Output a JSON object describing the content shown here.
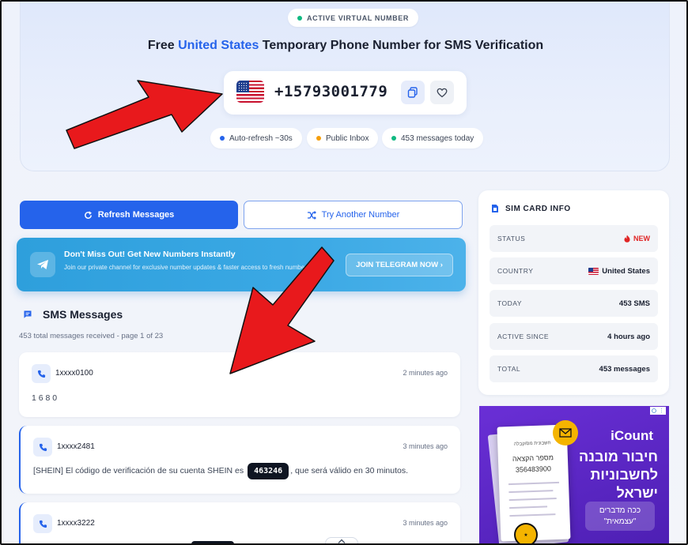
{
  "hero": {
    "badge": "ACTIVE VIRTUAL NUMBER",
    "title_prefix": "Free ",
    "title_country": "United States",
    "title_suffix": " Temporary Phone Number for SMS Verification",
    "phone_number": "+15793001779",
    "pills": [
      {
        "label": "Auto-refresh ~30s",
        "dot_color": "#2563eb"
      },
      {
        "label": "Public Inbox",
        "dot_color": "#f59e0b"
      },
      {
        "label": "453 messages today",
        "dot_color": "#10b981"
      }
    ]
  },
  "actions": {
    "refresh_label": "Refresh Messages",
    "try_label": "Try Another Number"
  },
  "telegram": {
    "title": "Don't Miss Out! Get New Numbers Instantly",
    "subtitle": "Join our private channel for exclusive number updates & faster access to fresh numbers",
    "button": "JOIN TELEGRAM NOW ›"
  },
  "sms": {
    "title": "SMS Messages",
    "count_text": "453 total messages received - page 1 of 23",
    "messages": [
      {
        "from": "1xxxx0100",
        "time": "2 minutes ago",
        "body": "1 6 8 0"
      },
      {
        "from": "1xxxx2481",
        "time": "3 minutes ago",
        "body_before": "[SHEIN] El código de verificación de su cuenta SHEIN es",
        "code": "463246",
        "body_after": ", que será válido en 30 minutos."
      },
      {
        "from": "1xxxx3222",
        "time": "3 minutes ago"
      }
    ]
  },
  "sim": {
    "title": "SIM CARD INFO",
    "rows": [
      {
        "label": "STATUS",
        "value": "NEW"
      },
      {
        "label": "COUNTRY",
        "value": "United States"
      },
      {
        "label": "TODAY",
        "value": "453 SMS"
      },
      {
        "label": "ACTIVE SINCE",
        "value": "4 hours ago"
      },
      {
        "label": "TOTAL",
        "value": "453 messages"
      }
    ]
  },
  "ad": {
    "brand": "iCount",
    "headline": "חיבור מובנה לחשבוניות ישראל",
    "cta": "ככה מדברים \"עצמאית\"",
    "doc_line1": "חשבונית מס/קבלה",
    "doc_line2": "מספר הקצאה",
    "doc_line3": "356483900"
  },
  "colors": {
    "accent": "#2563eb",
    "telegram": "#2e9fdc",
    "arrow": "#e8191c",
    "status_new": "#e02424",
    "ad_purple": "#5b25c4"
  }
}
